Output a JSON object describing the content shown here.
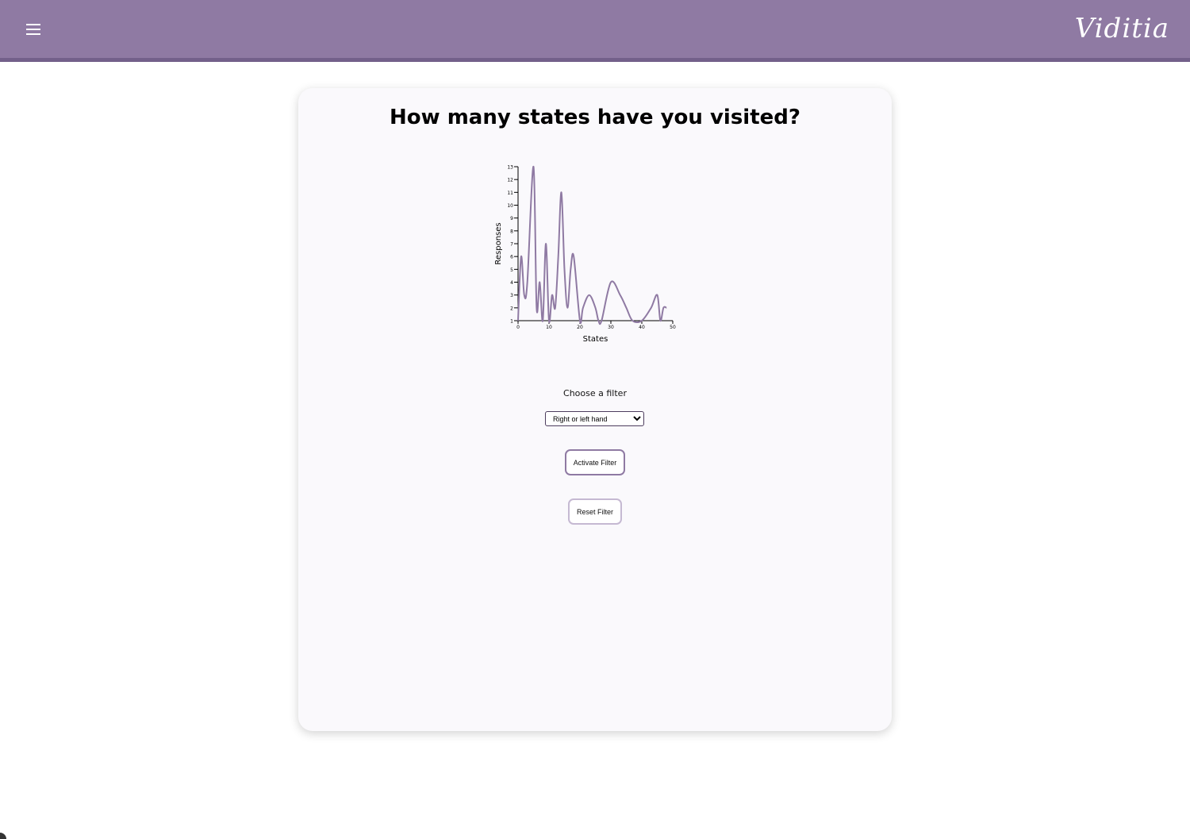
{
  "header": {
    "menu_icon": "hamburger-menu-icon",
    "logo_text": "Viditia",
    "bar_color": "#8f7aa3"
  },
  "card": {
    "title": "How many states have you visited?"
  },
  "chart_data": {
    "type": "line",
    "xlabel": "States",
    "ylabel": "Responses",
    "xlim": [
      0,
      50
    ],
    "ylim": [
      1,
      13
    ],
    "xticks": [
      0,
      10,
      20,
      30,
      40,
      50
    ],
    "yticks": [
      1,
      2,
      3,
      4,
      5,
      6,
      7,
      8,
      9,
      10,
      11,
      12,
      13
    ],
    "grid": false,
    "color": "#8f7aa3",
    "series": [
      {
        "x": [
          0,
          1,
          2,
          3,
          5,
          6,
          7,
          8,
          9,
          10,
          11,
          12,
          13,
          14,
          15,
          16,
          17,
          18,
          20,
          21,
          23,
          25,
          26,
          27,
          30,
          33,
          35,
          37,
          40,
          43,
          45,
          46,
          47,
          48
        ],
        "y": [
          1,
          6,
          3,
          4,
          13,
          2,
          4,
          1,
          7,
          1,
          3,
          2,
          6,
          11,
          5,
          2,
          5,
          6,
          1,
          2,
          3,
          2,
          1,
          1,
          4,
          3,
          2,
          1,
          1,
          2,
          3,
          1,
          2,
          2
        ]
      }
    ]
  },
  "filter": {
    "label": "Choose a filter",
    "selected": "Right or left hand",
    "options": [
      "Right or left hand"
    ]
  },
  "buttons": {
    "activate_label": "Activate Filter",
    "reset_label": "Reset Filter"
  }
}
